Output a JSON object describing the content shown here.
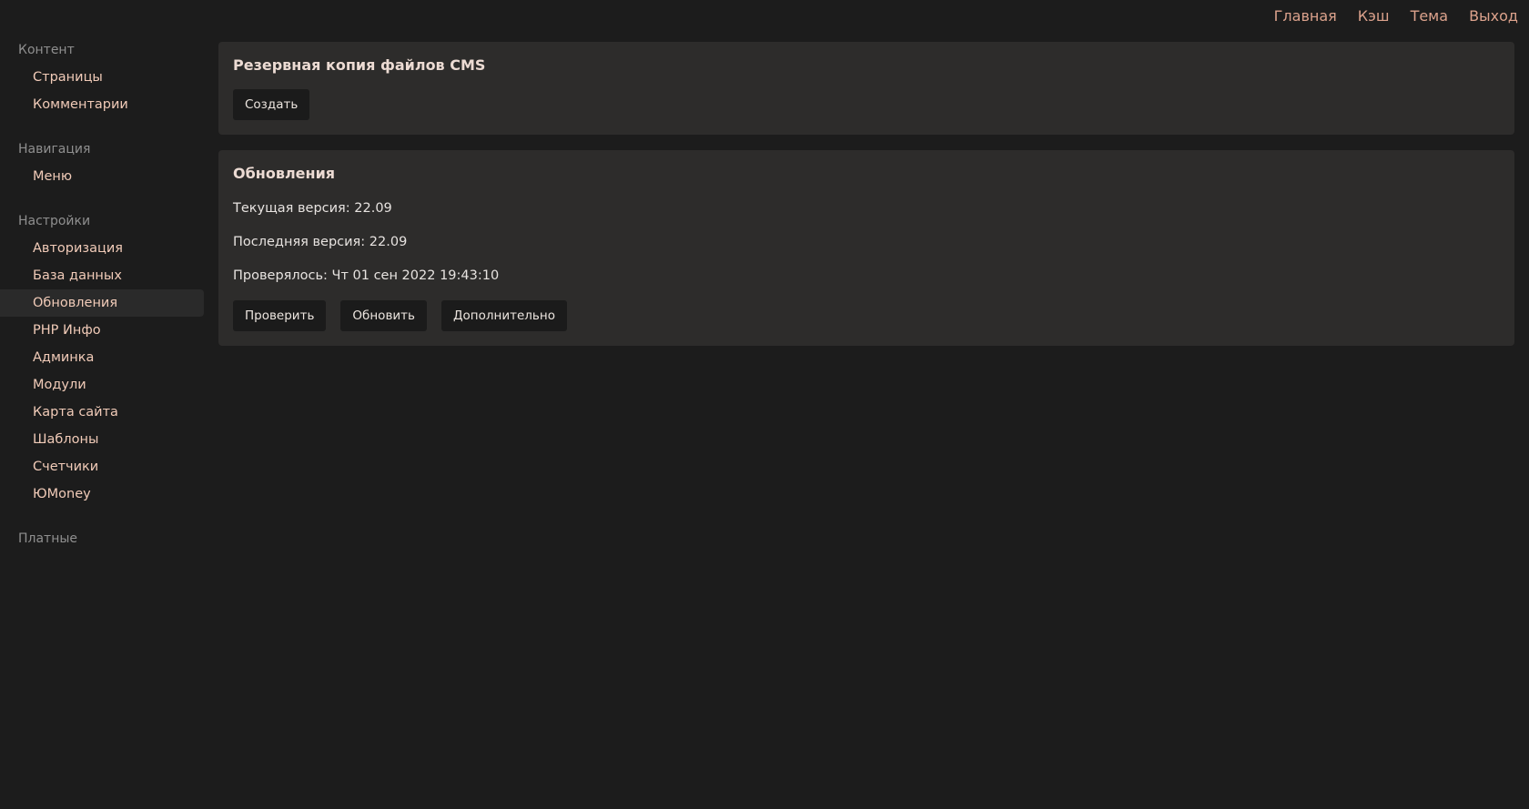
{
  "topnav": {
    "home": "Главная",
    "cache": "Кэш",
    "theme": "Тема",
    "logout": "Выход"
  },
  "sidebar": {
    "groups": [
      {
        "title": "Контент",
        "items": [
          "Страницы",
          "Комментарии"
        ]
      },
      {
        "title": "Навигация",
        "items": [
          "Меню"
        ]
      },
      {
        "title": "Настройки",
        "items": [
          "Авторизация",
          "База данных",
          "Обновления",
          "PHP Инфо",
          "Админка",
          "Модули",
          "Карта сайта",
          "Шаблоны",
          "Счетчики",
          "ЮMoney"
        ]
      },
      {
        "title": "Платные",
        "items": []
      }
    ],
    "active_item": "Обновления"
  },
  "backup": {
    "title": "Резервная копия файлов CMS",
    "create_label": "Создать"
  },
  "updates": {
    "title": "Обновления",
    "current_version": "Текущая версия: 22.09",
    "latest_version": "Последняя версия: 22.09",
    "checked_at": "Проверялось: Чт 01 сен 2022 19:43:10",
    "check_label": "Проверить",
    "update_label": "Обновить",
    "advanced_label": "Дополнительно"
  },
  "colors": {
    "background": "#1c1c1c",
    "card": "#2d2c2b",
    "accent_link": "#dca28c",
    "sidebar_item": "#f1cbb8",
    "sidebar_head": "#8f8f8f"
  }
}
